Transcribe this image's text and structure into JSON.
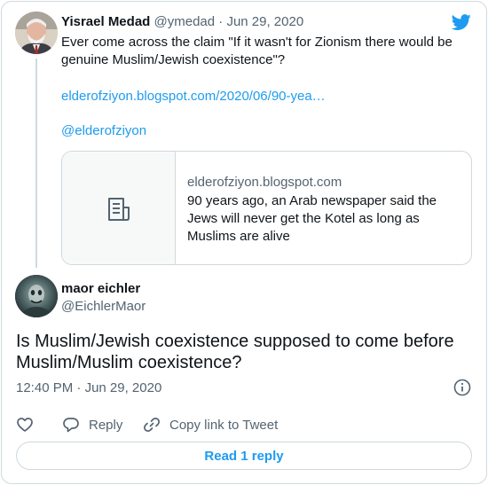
{
  "tweet1": {
    "author_name": "Yisrael Medad",
    "handle": "@ymedad",
    "separator": "·",
    "date": "Jun 29, 2020",
    "text": "Ever come across the claim \"If it wasn't for Zionism there would be genuine Muslim/Jewish coexistence\"?",
    "link": "elderofziyon.blogspot.com/2020/06/90-yea…",
    "mention": "@elderofziyon",
    "link_card": {
      "domain": "elderofziyon.blogspot.com",
      "description": "90 years ago, an Arab newspaper said the Jews will never get the Kotel as long as Muslims are alive",
      "icon": "document-icon"
    }
  },
  "tweet2": {
    "author_name": "maor eichler",
    "handle": "@EichlerMaor",
    "text": "Is Muslim/Jewish coexistence supposed to come before Muslim/Muslim coexistence?",
    "time": "12:40 PM",
    "separator": "·",
    "date": "Jun 29, 2020"
  },
  "actions": {
    "like_icon": "heart-icon",
    "reply_label": "Reply",
    "copy_label": "Copy link to Tweet"
  },
  "read_reply_label": "Read 1 reply",
  "colors": {
    "accent": "#1d9bf0",
    "text": "#0f1419",
    "muted": "#536471",
    "border": "#cfd9de"
  }
}
